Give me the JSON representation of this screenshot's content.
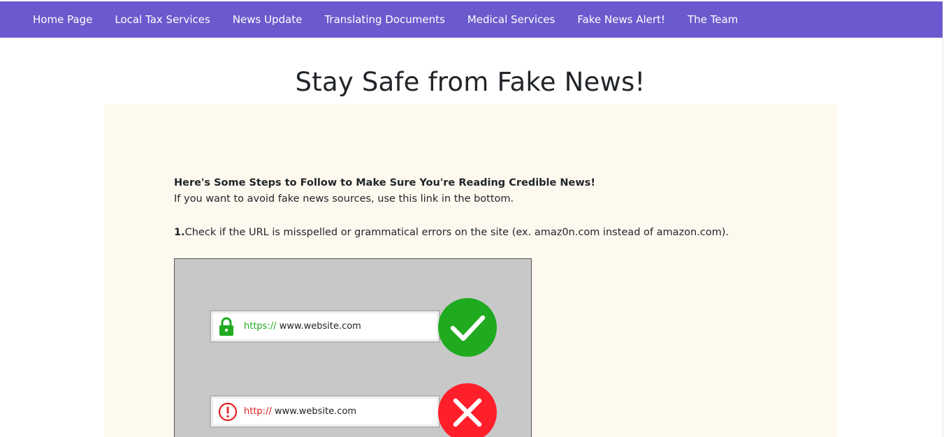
{
  "nav": {
    "items": [
      {
        "label": "Home Page"
      },
      {
        "label": "Local Tax Services"
      },
      {
        "label": "News Update"
      },
      {
        "label": "Translating Documents"
      },
      {
        "label": "Medical Services"
      },
      {
        "label": "Fake News Alert!"
      },
      {
        "label": "The Team"
      }
    ]
  },
  "page": {
    "title": "Stay Safe from Fake News!"
  },
  "content": {
    "heading": "Here's Some Steps to Follow to Make Sure You're Reading Credible News!",
    "intro": "If you want to avoid fake news sources, use this link in the bottom.",
    "step1": {
      "number": "1.",
      "text": "Check if the URL is misspelled or grammatical errors on the site (ex. amaz0n.com instead of amazon.com)."
    },
    "illustration": {
      "secure": {
        "protocol": "https://",
        "domain": "www.website.com",
        "icon": "padlock-icon",
        "badge": "checkmark-icon"
      },
      "insecure": {
        "protocol": "http://",
        "domain": "www.website.com",
        "icon": "exclamation-icon",
        "badge": "x-mark-icon"
      }
    }
  },
  "colors": {
    "navbar": "#6a5acd",
    "content_bg": "#fdf9ef",
    "illustration_bg": "#c8c8c8",
    "secure_green": "#1faa1f",
    "insecure_red": "#e02020"
  }
}
